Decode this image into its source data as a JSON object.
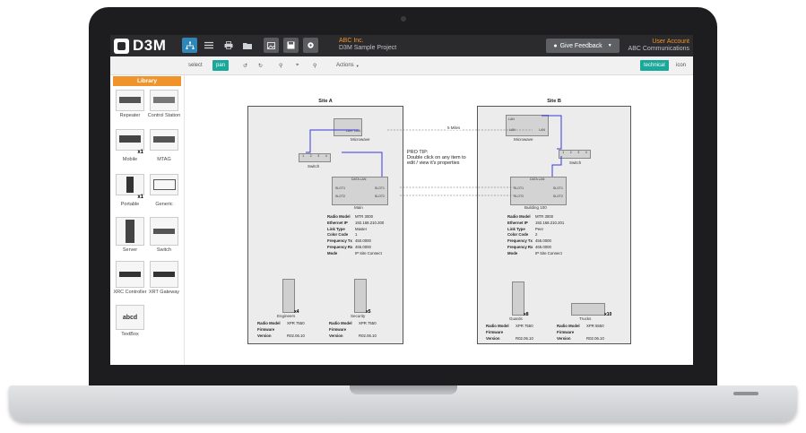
{
  "app": {
    "logo": "D3M",
    "company": "ABC Inc.",
    "project": "D3M Sample Project",
    "feedback_label": "Give Feedback",
    "user_account": "User Account",
    "user_company": "ABC Communications"
  },
  "toolbar": {
    "select": "select",
    "pan": "pan",
    "actions": "Actions",
    "view_technical": "technical",
    "view_icon": "icon"
  },
  "library": {
    "title": "Library",
    "items": [
      "Repeater",
      "Control Station",
      "Mobile",
      "MTAG",
      "Portable",
      "Generic",
      "Server",
      "Switch",
      "XRC Controller",
      "XRT Gateway",
      "TextBox"
    ],
    "mobile_count": "x1",
    "portable_count": "x1",
    "textbox_sample": "abcd"
  },
  "diagram": {
    "site_a": {
      "title": "Site A",
      "microwave": "Microwave",
      "lan": "LAN",
      "switch": "Switch",
      "switch_ports": [
        "1",
        "2",
        "3",
        "4"
      ],
      "repeater": "Main",
      "data_lan": "DATA LAN",
      "slots": [
        "SLOT1",
        "SLOT2",
        "SLOT1",
        "SLOT2"
      ],
      "props": [
        [
          "Radio Model",
          "MTR 3000"
        ],
        [
          "Ethernet IP",
          "192.168.210.200"
        ],
        [
          "Link Type",
          "Master"
        ],
        [
          "Color Code",
          "1"
        ],
        [
          "Frequency Tx",
          "450.0000"
        ],
        [
          "Frequency Rx",
          "455.0000"
        ],
        [
          "Mode",
          "IP Site Connect"
        ]
      ],
      "group1": {
        "name": "Engineers",
        "count": "x4",
        "model_label": "Radio Model",
        "model": "XPR 7550",
        "fw_label": "Firmware Version",
        "fw": "R02.06.10"
      },
      "group2": {
        "name": "Security",
        "count": "x5",
        "model_label": "Radio Model",
        "model": "XPR 7550",
        "fw_label": "Firmware Version",
        "fw": "R02.06.10"
      }
    },
    "site_b": {
      "title": "Site B",
      "microwave": "Microwave",
      "lan": "LAN",
      "switch": "Switch",
      "switch_ports": [
        "1",
        "2",
        "3",
        "4"
      ],
      "repeater": "Building 100",
      "data_lan": "DATA LAN",
      "slots": [
        "SLOT1",
        "SLOT2",
        "SLOT1",
        "SLOT2"
      ],
      "props": [
        [
          "Radio Model",
          "MTR 3000"
        ],
        [
          "Ethernet IP",
          "192.168.210.201"
        ],
        [
          "Link Type",
          "Peer"
        ],
        [
          "Color Code",
          "2"
        ],
        [
          "Frequency Tx",
          "455.0000"
        ],
        [
          "Frequency Rx",
          "465.0000"
        ],
        [
          "Mode",
          "IP Site Connect"
        ]
      ],
      "group1": {
        "name": "Guards",
        "count": "x8",
        "model_label": "Radio Model",
        "model": "XPR 7550",
        "fw_label": "Firmware Version",
        "fw": "R02.06.10"
      },
      "group2": {
        "name": "Trucks",
        "count": "x10",
        "model_label": "Radio Model",
        "model": "XPR 5550",
        "fw_label": "Firmware Version",
        "fw": "R02.06.10"
      }
    },
    "link_label": "5 Miles",
    "tip_line1": "PRO TIP:",
    "tip_line2": "Double click on any item to",
    "tip_line3": "edit / view it's properties"
  }
}
